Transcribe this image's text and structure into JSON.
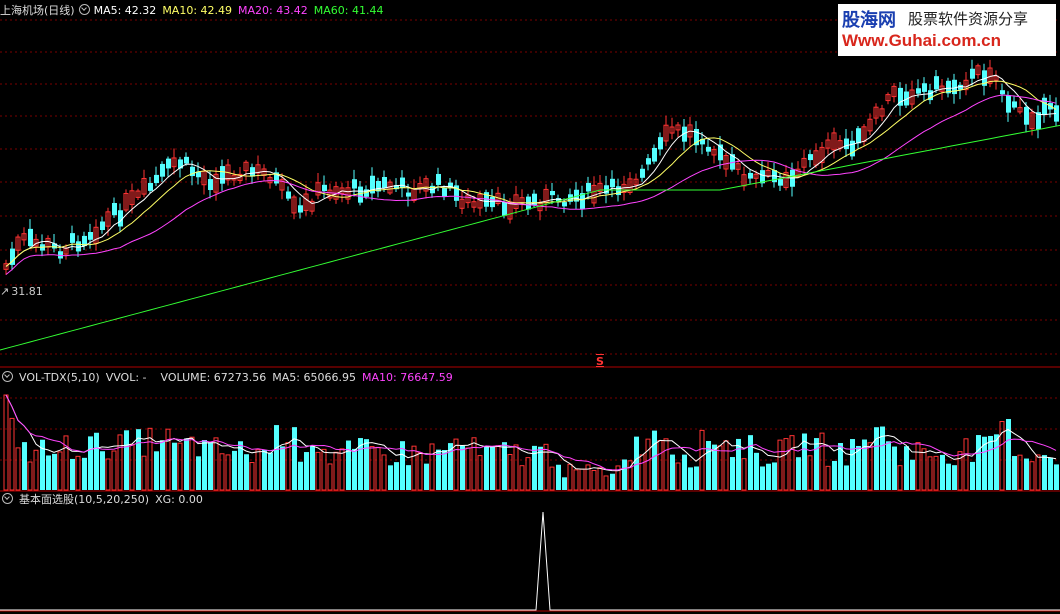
{
  "kline_header": {
    "title": "上海机场(日线)",
    "ma5": "MA5: 42.32",
    "ma10": "MA10: 42.49",
    "ma20": "MA20: 43.42",
    "ma60": "MA60: 41.44",
    "low_price_label": "31.81",
    "signal_marker": "S",
    "colors": {
      "ma5": "#ffffff",
      "ma10": "#ffff66",
      "ma20": "#ff44ff",
      "ma60": "#33ff33"
    }
  },
  "vol_header": {
    "name": "VOL-TDX(5,10)",
    "vvol": "VVOL: -",
    "volume": "VOLUME: 67273.56",
    "ma5": "MA5: 65066.95",
    "ma10": "MA10: 76647.59"
  },
  "ind_header": {
    "name": "基本面选股(10,5,20,250)",
    "xg": "XG: 0.00"
  },
  "watermark": {
    "brand": "股海网",
    "slogan": "股票软件资源分享",
    "url": "Www.Guhai.com.cn"
  },
  "colors": {
    "up": "#ff3333",
    "down": "#54ffff",
    "grid": "#7a0000",
    "frame": "#b00000"
  }
}
